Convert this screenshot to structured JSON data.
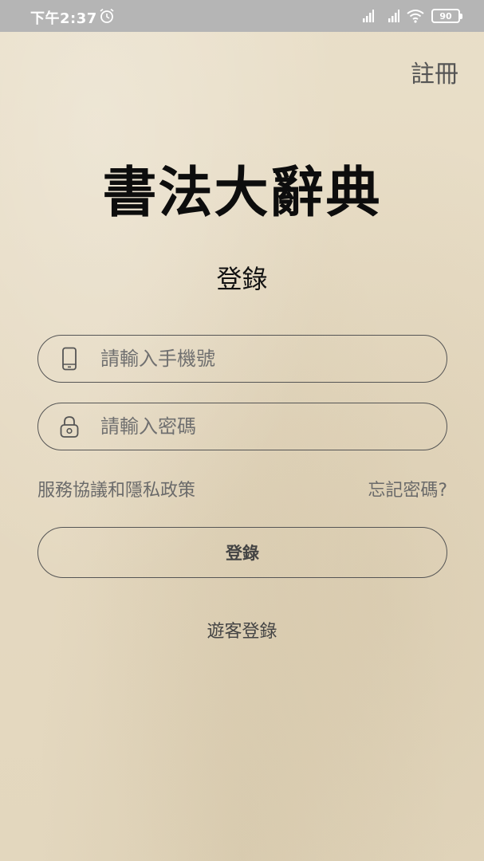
{
  "status_bar": {
    "time": "下午2:37",
    "battery": "90"
  },
  "header": {
    "register_label": "註冊"
  },
  "app_title": "書法大辭典",
  "login": {
    "section_title": "登錄",
    "phone_placeholder": "請輸入手機號",
    "password_placeholder": "請輸入密碼",
    "terms_link": "服務協議和隱私政策",
    "forgot_password_link": "忘記密碼?",
    "login_button_label": "登錄",
    "guest_login_label": "遊客登錄"
  },
  "icons": {
    "phone_field": "phone-icon",
    "password_field": "lock-icon",
    "status": [
      "alarm-icon",
      "signal-icon",
      "wifi-icon",
      "battery-icon"
    ]
  },
  "colors": {
    "background": "#e7dcc5",
    "status_bar": "#b5b5b5",
    "border": "#555555",
    "text_secondary": "#6a6a6a"
  }
}
